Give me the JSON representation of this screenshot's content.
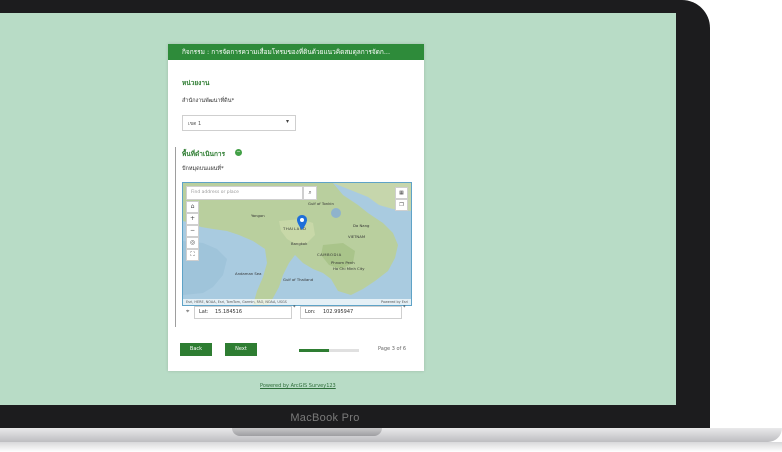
{
  "device": {
    "brand": "MacBook Pro"
  },
  "survey": {
    "header": "กิจกรรม : การจัดการความเสื่อมโทรมของที่ดินด้วยแนวคิดสมดุลการจัดก...",
    "section_unit": "หน่วยงาน",
    "field_office_label": "สำนักงานพัฒนาที่ดิน*",
    "field_office_value": "เขต 1",
    "section_area": "พื้นที่ดำเนินการ",
    "field_pin_label": "ปักหมุดบนแผนที่*",
    "map": {
      "search_placeholder": "Find address or place",
      "labels": {
        "gulf": "Gulf of Tonkin",
        "yangon": "Yangon",
        "thailand": "THAILAND",
        "bangkok": "Bangkok",
        "danang": "Da Nang",
        "vietnam": "VIETNAM",
        "cambodia": "CAMBODIA",
        "phnompenh": "Phnom Penh",
        "hcmc": "Ho Chi Minh City",
        "andaman": "Andaman Sea",
        "gulfthai": "Gulf of Thailand"
      },
      "attribution_left": "Esri, HERE, NOAA, Esri, TomTom, Garmin, FAO, NOAA, USGS",
      "attribution_right": "Powered by Esri"
    },
    "lat_label": "Lat:",
    "lat_value": "15.184516",
    "lon_label": "Lon:",
    "lon_value": "102.995947",
    "back_label": "Back",
    "next_label": "Next",
    "progress": 0.5,
    "page_indicator": "Page 3 of 6"
  },
  "footer": {
    "powered_by": "Powered by ArcGIS Survey123"
  }
}
